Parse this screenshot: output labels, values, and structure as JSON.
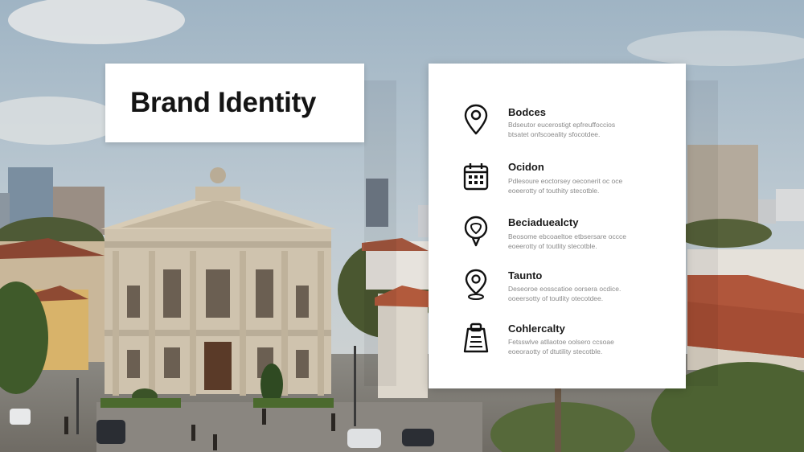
{
  "title": "Brand Identity",
  "items": [
    {
      "icon": "map-pin-icon",
      "title": "Bodces",
      "desc": "Bdseutor eucerostigt epfreuffoccios\nbtsatet onfscoeality sfocotdee."
    },
    {
      "icon": "calendar-icon",
      "title": "Ocidon",
      "desc": "Pdlesoure eoctorsey oeconerit oc oce\neoeerotty of touthity stecotble."
    },
    {
      "icon": "pin-badge-icon",
      "title": "Beciaduealcty",
      "desc": "Beosome ebcoaeltoe etbsersare occce\neoeerotty of toutlity stecotble."
    },
    {
      "icon": "location-pin-icon",
      "title": "Taunto",
      "desc": "Deseoroe eosscatioe oorsera ocdice.\nooeersotty of toutlity otecotdee."
    },
    {
      "icon": "clipboard-icon",
      "title": "Cohlercalty",
      "desc": "Fetsswlve atllaotoe oolsero ccsoae\neoeoraotty of dtutility stecotble."
    }
  ]
}
